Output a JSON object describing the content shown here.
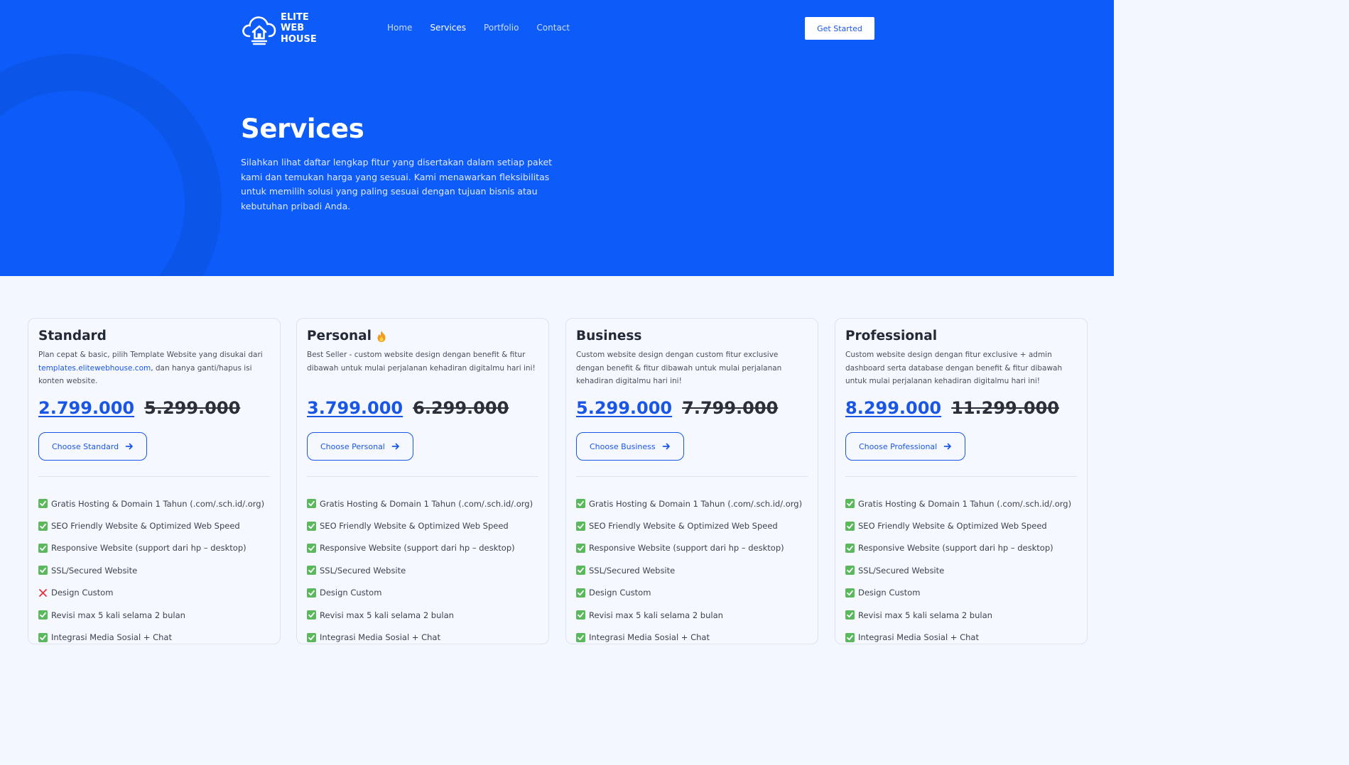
{
  "brand": {
    "line1": "ELITE",
    "line2": "WEB",
    "line3": "HOUSE"
  },
  "nav": {
    "items": [
      {
        "label": "Home",
        "active": false
      },
      {
        "label": "Services",
        "active": true
      },
      {
        "label": "Portfolio",
        "active": false
      },
      {
        "label": "Contact",
        "active": false
      }
    ],
    "cta_label": "Get Started"
  },
  "hero": {
    "title": "Services",
    "description": "Silahkan lihat daftar lengkap fitur yang disertakan dalam setiap paket kami dan temukan harga yang sesuai. Kami menawarkan fleksibilitas untuk memilih solusi yang paling sesuai dengan tujuan bisnis atau kebutuhan pribadi Anda."
  },
  "colors": {
    "primary": "#0d5bf8",
    "accent": "#1a56e6",
    "page_bg": "#f3f7fe",
    "check": "#5cb85c",
    "cross": "#e2373f"
  },
  "plans": [
    {
      "name": "Standard",
      "badge_icon": "",
      "desc_before": "Plan cepat & basic, pilih Template Website yang disukai dari ",
      "desc_link": "templates.elitewebhouse.com",
      "desc_after": ", dan hanya ganti/hapus isi konten website.",
      "price": "2.799.000",
      "old_price": "5.299.000",
      "button": "Choose Standard",
      "features": [
        {
          "text": "Gratis Hosting & Domain  1 Tahun (.com/.sch.id/.org)",
          "included": true
        },
        {
          "text": "SEO Friendly Website & Optimized Web Speed",
          "included": true
        },
        {
          "text": "Responsive Website (support dari hp – desktop)",
          "included": true
        },
        {
          "text": "SSL/Secured Website",
          "included": true
        },
        {
          "text": "Design Custom",
          "included": false
        },
        {
          "text": "Revisi max 5 kali selama 2 bulan",
          "included": true
        },
        {
          "text": "Integrasi Media Sosial + Chat",
          "included": true
        }
      ]
    },
    {
      "name": "Personal",
      "badge_icon": "fire-icon",
      "desc_before": "Best Seller - custom website design dengan benefit & fitur dibawah untuk mulai perjalanan kehadiran digitalmu hari ini!",
      "desc_link": "",
      "desc_after": "",
      "price": "3.799.000",
      "old_price": "6.299.000",
      "button": "Choose Personal",
      "features": [
        {
          "text": "Gratis Hosting & Domain  1 Tahun (.com/.sch.id/.org)",
          "included": true
        },
        {
          "text": "SEO Friendly Website & Optimized Web Speed",
          "included": true
        },
        {
          "text": "Responsive Website (support dari hp – desktop)",
          "included": true
        },
        {
          "text": "SSL/Secured Website",
          "included": true
        },
        {
          "text": "Design Custom",
          "included": true
        },
        {
          "text": "Revisi max 5 kali selama 2 bulan",
          "included": true
        },
        {
          "text": "Integrasi Media Sosial + Chat",
          "included": true
        }
      ]
    },
    {
      "name": "Business",
      "badge_icon": "",
      "desc_before": "Custom website design dengan custom fitur exclusive dengan benefit & fitur dibawah untuk mulai perjalanan kehadiran digitalmu hari ini!",
      "desc_link": "",
      "desc_after": "",
      "price": "5.299.000",
      "old_price": "7.799.000",
      "button": "Choose Business",
      "features": [
        {
          "text": "Gratis Hosting & Domain  1 Tahun (.com/.sch.id/.org)",
          "included": true
        },
        {
          "text": "SEO Friendly Website & Optimized Web Speed",
          "included": true
        },
        {
          "text": "Responsive Website (support dari hp – desktop)",
          "included": true
        },
        {
          "text": "SSL/Secured Website",
          "included": true
        },
        {
          "text": "Design Custom",
          "included": true
        },
        {
          "text": "Revisi max 5 kali selama 2 bulan",
          "included": true
        },
        {
          "text": "Integrasi Media Sosial + Chat",
          "included": true
        }
      ]
    },
    {
      "name": "Professional",
      "badge_icon": "",
      "desc_before": "Custom website design dengan fitur exclusive + admin dashboard serta database dengan benefit & fitur dibawah untuk mulai perjalanan kehadiran digitalmu hari ini!",
      "desc_link": "",
      "desc_after": "",
      "price": "8.299.000",
      "old_price": "11.299.000",
      "button": "Choose Professional",
      "features": [
        {
          "text": "Gratis Hosting & Domain  1 Tahun (.com/.sch.id/.org)",
          "included": true
        },
        {
          "text": "SEO Friendly Website & Optimized Web Speed",
          "included": true
        },
        {
          "text": "Responsive Website (support dari hp – desktop)",
          "included": true
        },
        {
          "text": "SSL/Secured Website",
          "included": true
        },
        {
          "text": "Design Custom",
          "included": true
        },
        {
          "text": "Revisi max 5 kali selama 2 bulan",
          "included": true
        },
        {
          "text": "Integrasi Media Sosial + Chat",
          "included": true
        }
      ]
    }
  ]
}
